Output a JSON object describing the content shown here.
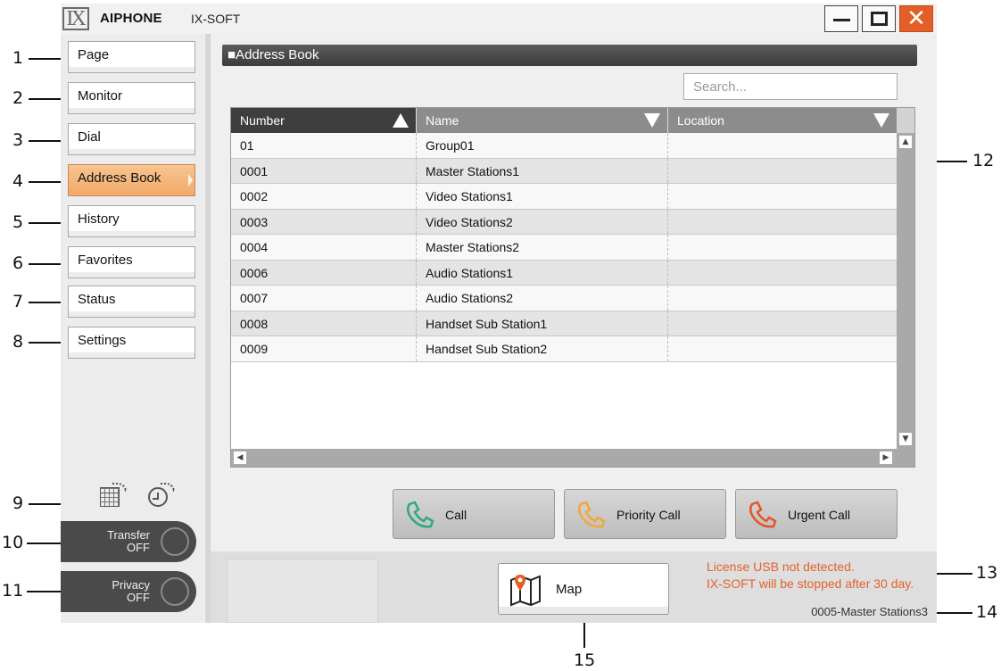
{
  "window": {
    "brand": "AIPHONE",
    "product": "IX-SOFT",
    "logo": "IX",
    "close_symbol": "✕"
  },
  "sidebar": {
    "items": [
      {
        "label": "Page"
      },
      {
        "label": "Monitor"
      },
      {
        "label": "Dial"
      },
      {
        "label": "Address Book",
        "active": true
      },
      {
        "label": "History"
      },
      {
        "label": "Favorites"
      },
      {
        "label": "Status"
      },
      {
        "label": "Settings"
      }
    ],
    "transfer": {
      "label": "Transfer",
      "state": "OFF"
    },
    "privacy": {
      "label": "Privacy",
      "state": "OFF"
    }
  },
  "main": {
    "section_title": "■Address Book",
    "search_placeholder": "Search...",
    "table": {
      "columns": [
        "Number",
        "Name",
        "Location"
      ],
      "sorted_column": "Number",
      "rows": [
        [
          "01",
          "Group01",
          ""
        ],
        [
          "0001",
          "Master Stations1",
          ""
        ],
        [
          "0002",
          "Video Stations1",
          ""
        ],
        [
          "0003",
          "Video Stations2",
          ""
        ],
        [
          "0004",
          "Master Stations2",
          ""
        ],
        [
          "0006",
          "Audio Stations1",
          ""
        ],
        [
          "0007",
          "Audio Stations2",
          ""
        ],
        [
          "0008",
          "Handset Sub Station1",
          ""
        ],
        [
          "0009",
          "Handset Sub Station2",
          ""
        ]
      ]
    },
    "call_buttons": [
      {
        "label": "Call",
        "color": "#2fa882"
      },
      {
        "label": "Priority Call",
        "color": "#f0a83a"
      },
      {
        "label": "Urgent Call",
        "color": "#e4552a"
      }
    ]
  },
  "footer": {
    "map_label": "Map",
    "license_line1": "License USB not detected.",
    "license_line2": "IX-SOFT will be stopped after 30 day.",
    "station": "0005-Master Stations3",
    "license_color": "#e3622a"
  },
  "callouts": [
    "1",
    "2",
    "3",
    "4",
    "5",
    "6",
    "7",
    "8",
    "9",
    "10",
    "11",
    "12",
    "13",
    "14",
    "15"
  ]
}
